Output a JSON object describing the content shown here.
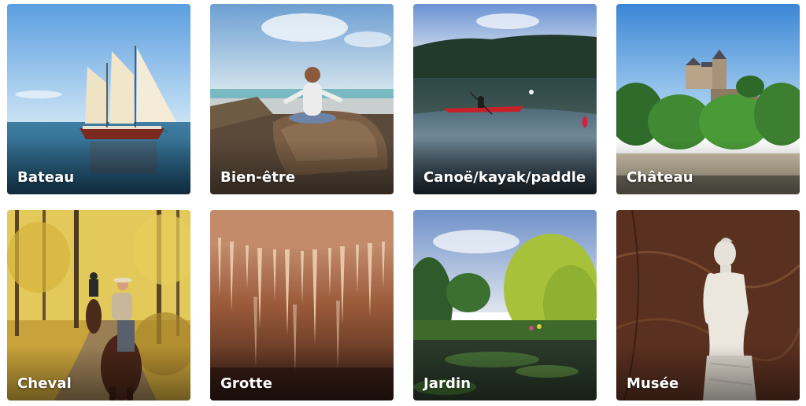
{
  "activities": [
    {
      "label": "Bateau",
      "icon": "sailboat-photo"
    },
    {
      "label": "Bien-être",
      "icon": "meditation-photo"
    },
    {
      "label": "Canoë/kayak/paddle",
      "icon": "kayak-lake-photo"
    },
    {
      "label": "Château",
      "icon": "castle-photo"
    },
    {
      "label": "Cheval",
      "icon": "horse-riding-photo"
    },
    {
      "label": "Grotte",
      "icon": "cave-photo"
    },
    {
      "label": "Jardin",
      "icon": "garden-pond-photo"
    },
    {
      "label": "Musée",
      "icon": "statue-photo"
    }
  ]
}
